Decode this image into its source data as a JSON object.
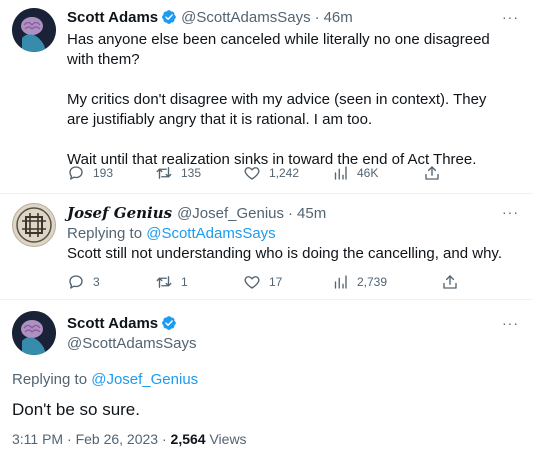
{
  "tweet1": {
    "name": "Scott Adams",
    "handle": "@ScottAdamsSays",
    "time": "46m",
    "para1": "Has anyone else been canceled while literally no one disagreed with them?",
    "para2": "My critics don't disagree with my advice (seen in context). They are justifiably angry that it is rational. I am too.",
    "para3": "Wait until that realization sinks in toward the end of Act Three.",
    "replies": "193",
    "retweets": "135",
    "likes": "1,242",
    "views": "46K"
  },
  "tweet2": {
    "name": "Josef Genius",
    "handle": "@Josef_Genius",
    "time": "45m",
    "replying_prefix": "Replying to ",
    "replying_to": "@ScottAdamsSays",
    "text": "Scott still not understanding who is doing the cancelling, and why.",
    "replies": "3",
    "retweets": "1",
    "likes": "17",
    "views": "2,739"
  },
  "tweet3": {
    "name": "Scott Adams",
    "handle": "@ScottAdamsSays",
    "replying_prefix": "Replying to ",
    "replying_to": "@Josef_Genius",
    "text": "Don't be so sure.",
    "time": "3:11 PM",
    "date": "Feb 26, 2023",
    "views_count": "2,564",
    "views_label": "Views"
  },
  "separator": "·",
  "more_glyph": "···",
  "icons": [
    "verified-badge-icon",
    "reply-icon",
    "retweet-icon",
    "like-icon",
    "views-icon",
    "share-icon",
    "more-icon"
  ],
  "colors": {
    "link": "#1d9bf0",
    "muted": "#536471",
    "text": "#0f1419",
    "verified": "#1d9bf0"
  }
}
